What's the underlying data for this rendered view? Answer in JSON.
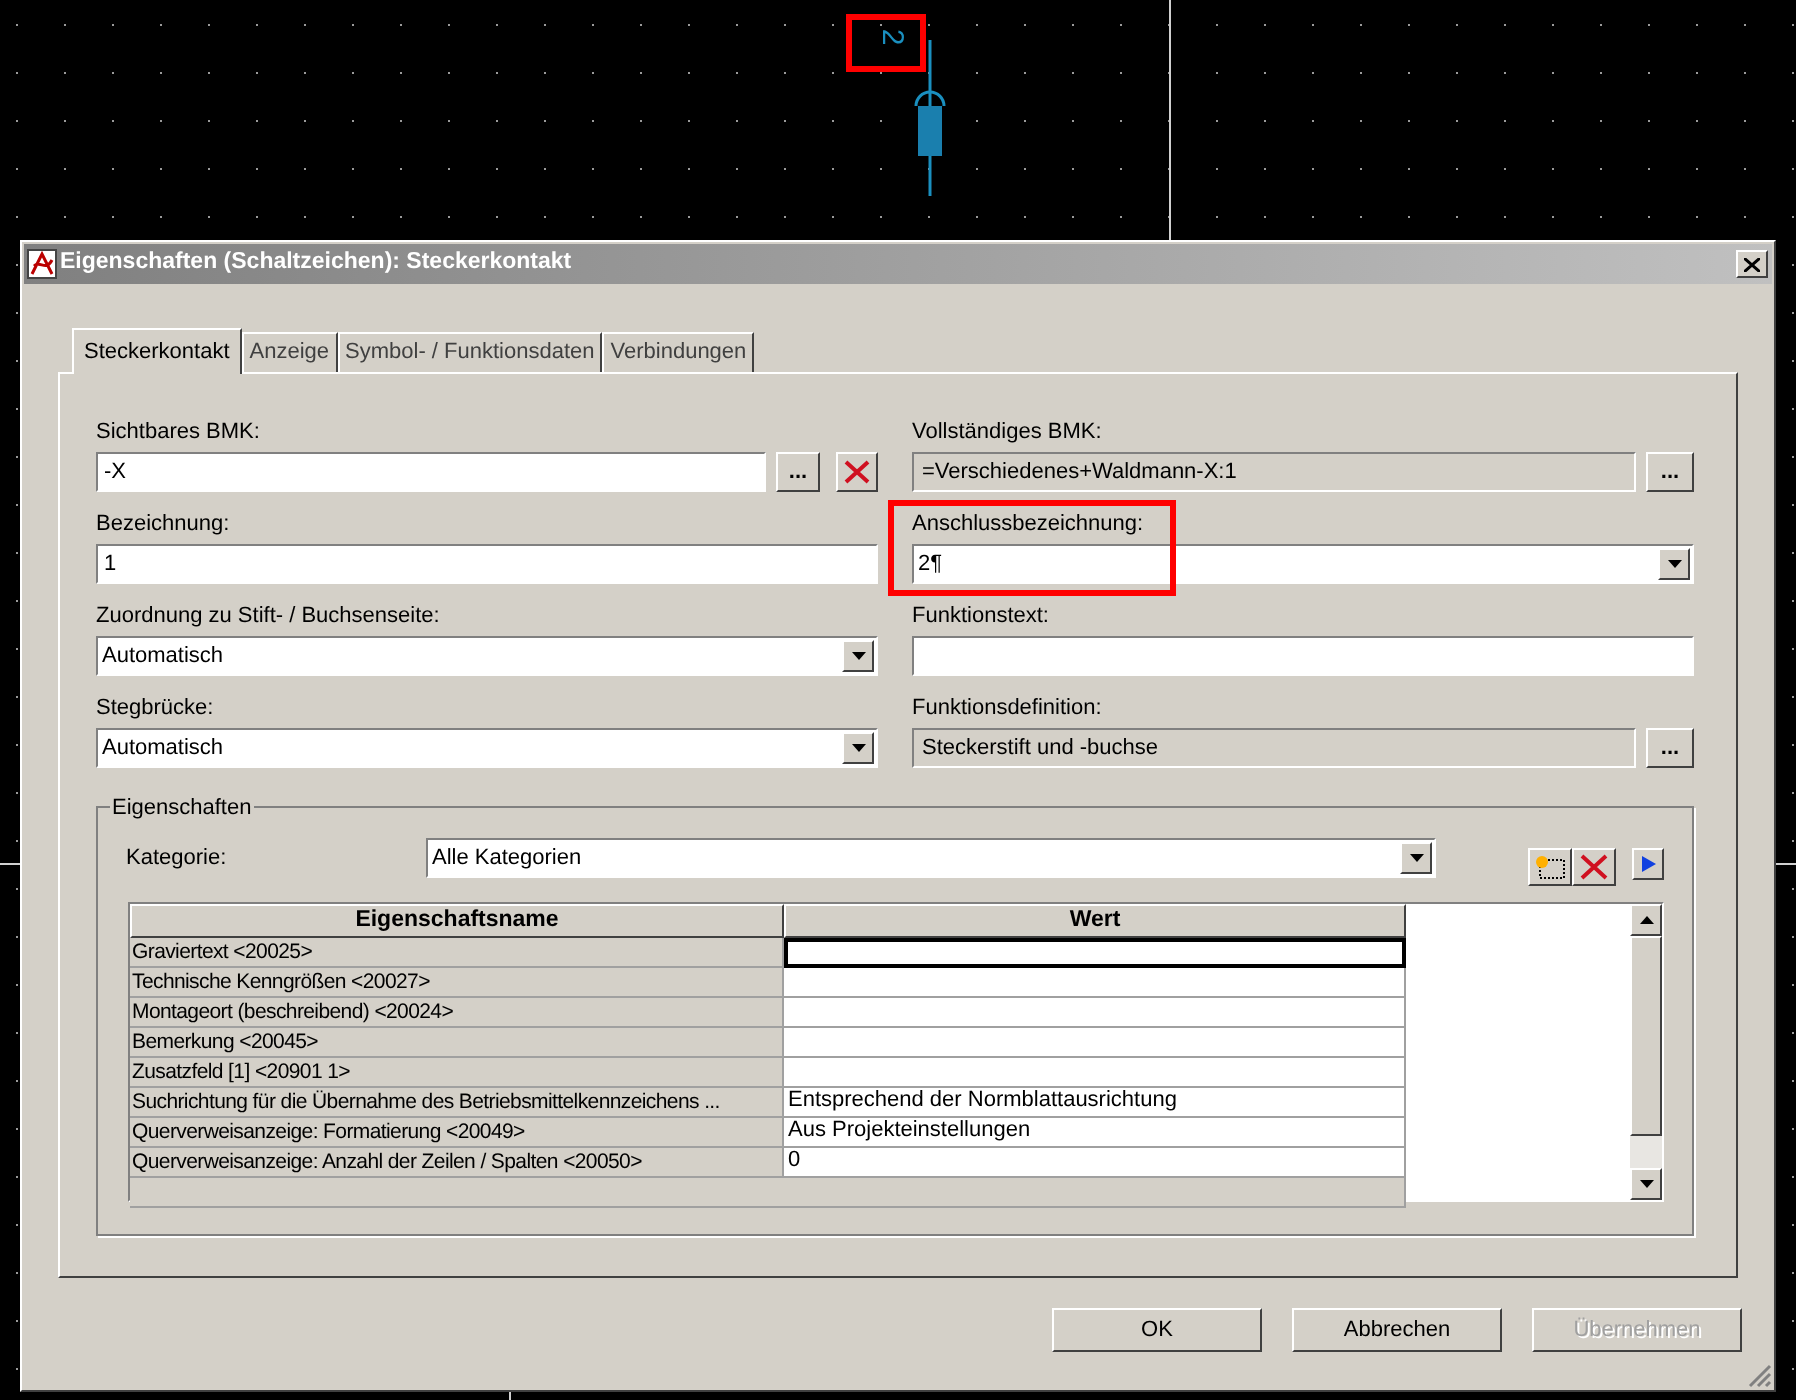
{
  "canvas": {
    "pin_label": "2",
    "pin_label_highlighted": true
  },
  "window": {
    "title": "Eigenschaften (Schaltzeichen): Steckerkontakt"
  },
  "tabs": [
    {
      "label": "Steckerkontakt",
      "selected": true
    },
    {
      "label": "Anzeige",
      "selected": false
    },
    {
      "label": "Symbol- / Funktionsdaten",
      "selected": false
    },
    {
      "label": "Verbindungen",
      "selected": false
    }
  ],
  "left_fields": [
    {
      "kind": "text_with_buttons",
      "label": "Sichtbares BMK:",
      "value": "-X",
      "button_label": "...",
      "highlighted": false
    },
    {
      "kind": "text",
      "label": "Bezeichnung:",
      "value": "1",
      "highlighted": false
    },
    {
      "kind": "dropdown",
      "label": "Zuordnung zu Stift- / Buchsenseite:",
      "value": "Automatisch",
      "highlighted": false
    },
    {
      "kind": "dropdown",
      "label": "Stegbrücke:",
      "value": "Automatisch",
      "highlighted": false
    }
  ],
  "right_fields": [
    {
      "kind": "readonly_with_button",
      "label": "Vollständiges BMK:",
      "value": "=Verschiedenes+Waldmann-X:1",
      "button_label": "...",
      "highlighted": false
    },
    {
      "kind": "dropdown",
      "label": "Anschlussbezeichnung:",
      "value": "2¶",
      "highlighted": true
    },
    {
      "kind": "text",
      "label": "Funktionstext:",
      "highlighted": false
    },
    {
      "kind": "readonly_with_button",
      "label": "Funktionsdefinition:",
      "value": "Steckerstift und -buchse",
      "button_label": "...",
      "highlighted": false
    }
  ],
  "properties": {
    "title": "Eigenschaften",
    "category_label": "Kategorie:",
    "category_value": "Alle Kategorien",
    "columns": [
      "Eigenschaftsname",
      "Wert"
    ],
    "rows": [
      {
        "name": "Graviertext <20025>",
        "value": "",
        "selected": true
      },
      {
        "name": "Technische Kenngrößen <20027>",
        "value": "",
        "selected": false
      },
      {
        "name": "Montageort (beschreibend) <20024>",
        "value": "",
        "selected": false
      },
      {
        "name": "Bemerkung <20045>",
        "value": "",
        "selected": false
      },
      {
        "name": "Zusatzfeld [1] <20901 1>",
        "value": "",
        "selected": false
      },
      {
        "name": "Suchrichtung für die Übernahme des Betriebsmittelkennzeichens ...",
        "value": "Entsprechend der Normblattausrichtung",
        "selected": false
      },
      {
        "name": "Querverweisanzeige: Formatierung <20049>",
        "value": "Aus Projekteinstellungen",
        "selected": false
      },
      {
        "name": "Querverweisanzeige: Anzahl der Zeilen / Spalten <20050>",
        "value": "0",
        "selected": false
      }
    ]
  },
  "buttons": [
    {
      "label": "OK",
      "disabled": false
    },
    {
      "label": "Abbrechen",
      "disabled": false
    },
    {
      "label": "Übernehmen",
      "disabled": true
    }
  ]
}
